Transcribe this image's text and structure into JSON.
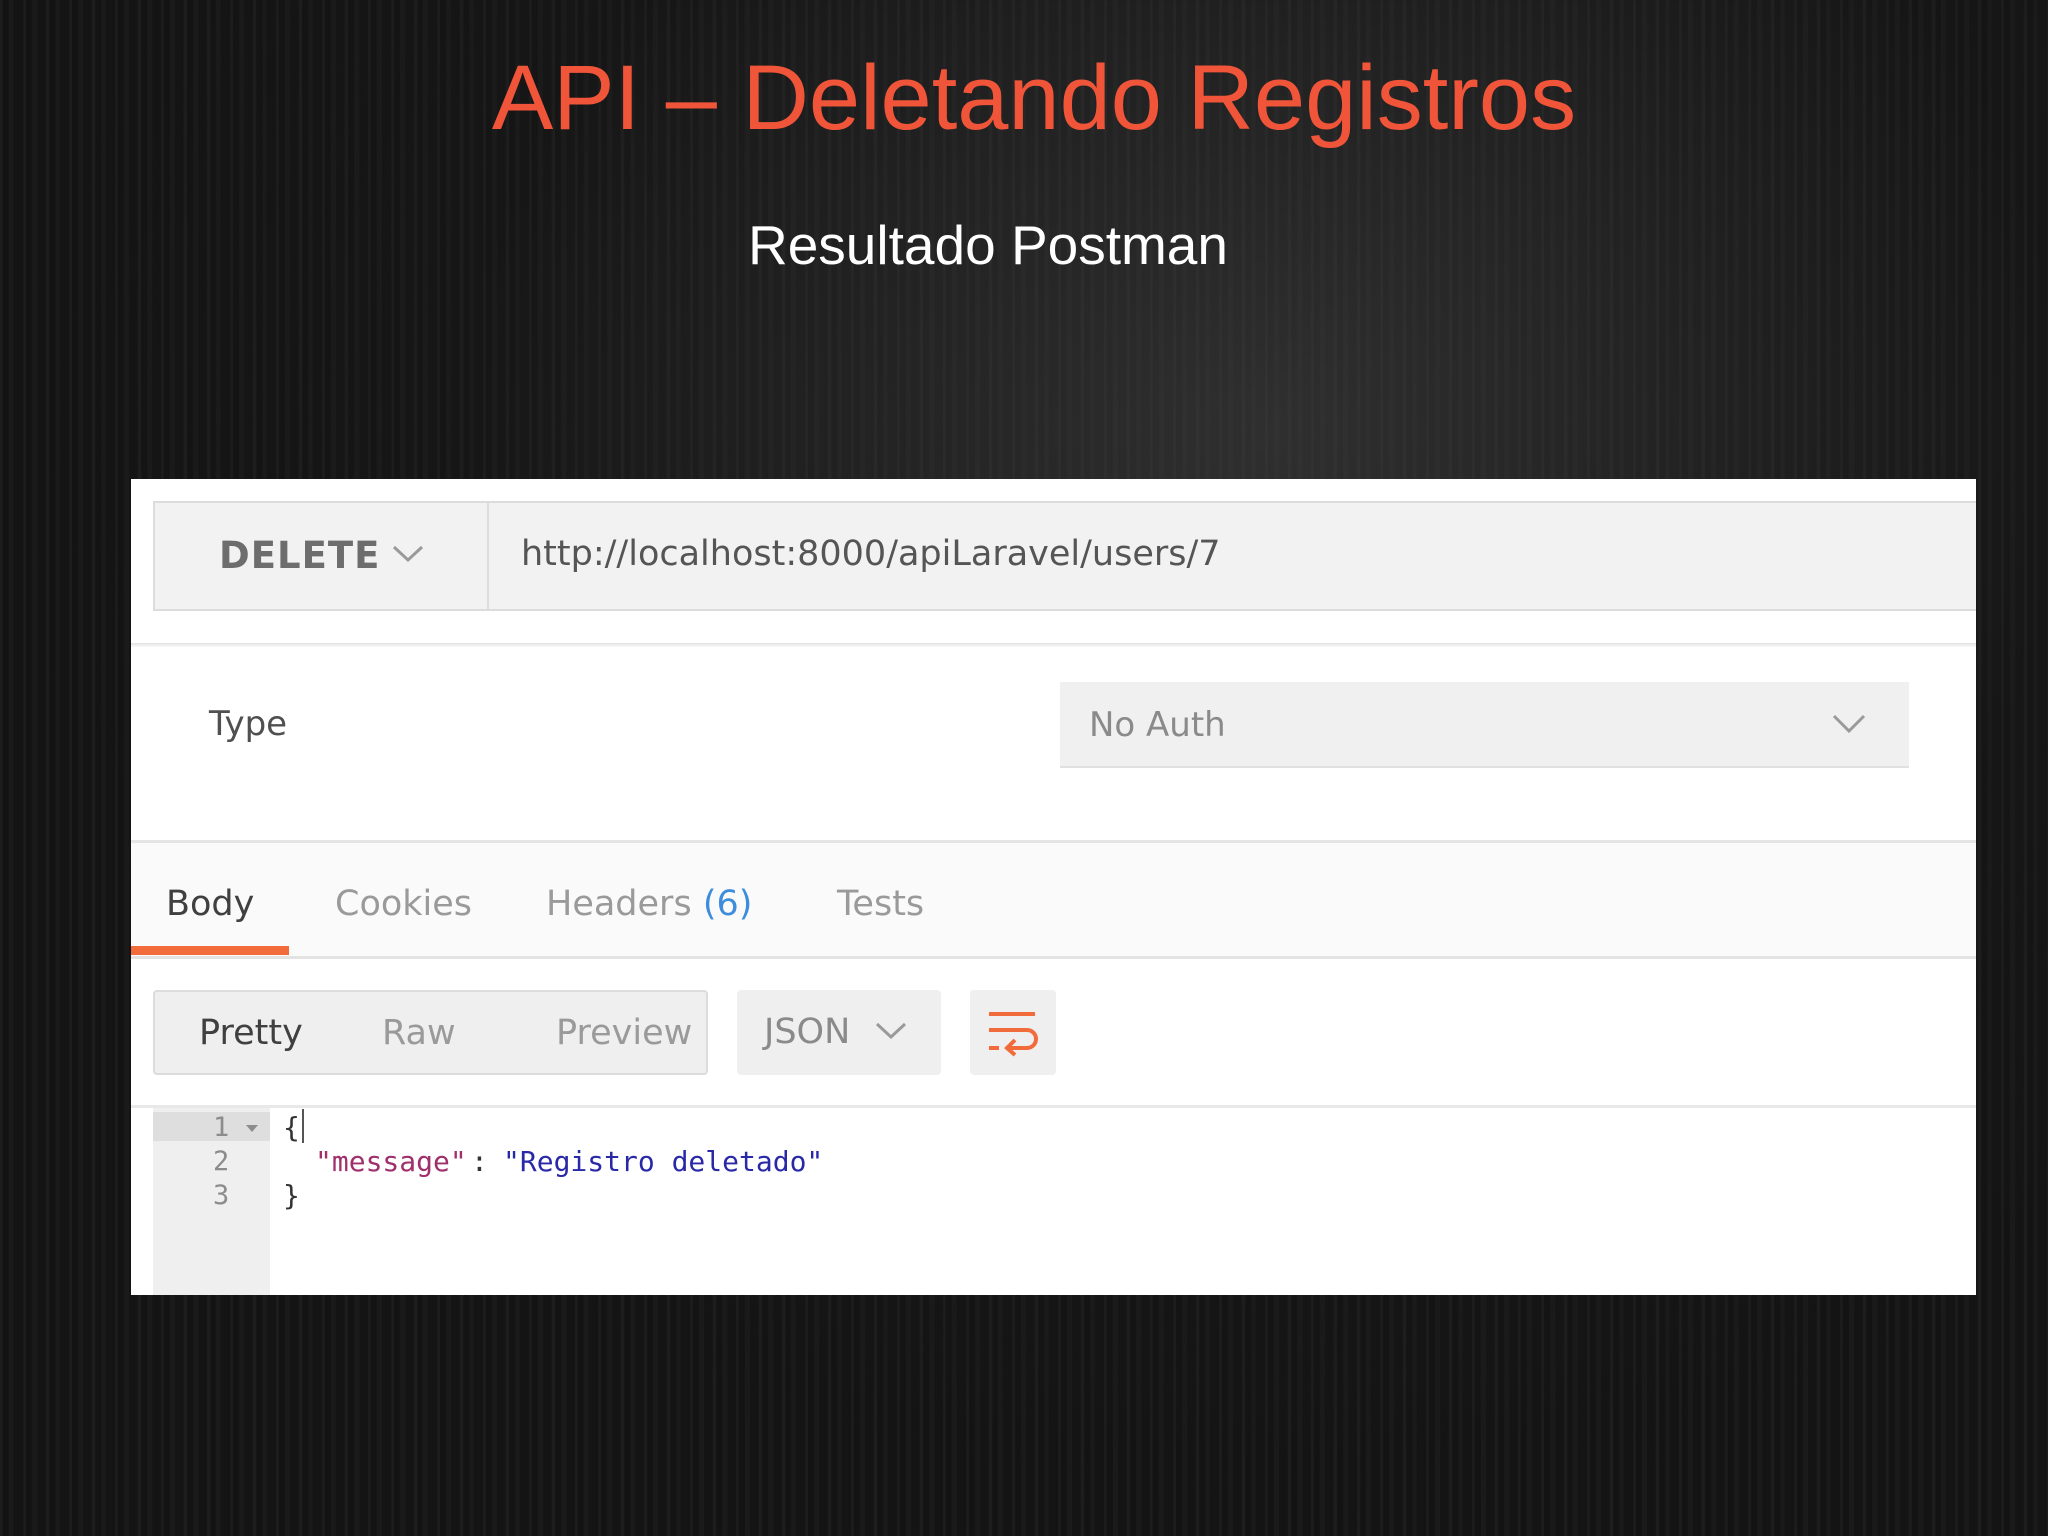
{
  "slide": {
    "title": "API – Deletando Registros",
    "subtitle": "Resultado Postman"
  },
  "request": {
    "method": "DELETE",
    "url": "http://localhost:8000/apiLaravel/users/7"
  },
  "auth": {
    "type_label": "Type",
    "selected": "No Auth"
  },
  "response": {
    "tabs": [
      {
        "label": "Body",
        "active": true
      },
      {
        "label": "Cookies",
        "active": false
      },
      {
        "label": "Headers",
        "count": "(6)",
        "active": false
      },
      {
        "label": "Tests",
        "active": false
      }
    ],
    "view_modes": [
      {
        "label": "Pretty",
        "active": true
      },
      {
        "label": "Raw",
        "active": false
      },
      {
        "label": "Preview",
        "active": false
      }
    ],
    "format": "JSON",
    "line_numbers": [
      "1",
      "2",
      "3"
    ],
    "code": {
      "open_brace": "{",
      "key": "\"message\"",
      "colon": ":",
      "value": "\"Registro deletado\"",
      "close_brace": "}"
    }
  },
  "colors": {
    "title": "#f0553a",
    "accent": "#f26b3a",
    "json_key": "#a0306b",
    "json_string": "#2929a8",
    "headers_count": "#3d8ddc"
  },
  "icons": {
    "method_dropdown": "chevron-down-icon",
    "auth_dropdown": "chevron-down-icon",
    "format_dropdown": "chevron-down-icon",
    "wrap": "wrap-lines-icon",
    "fold": "fold-triangle-icon"
  }
}
